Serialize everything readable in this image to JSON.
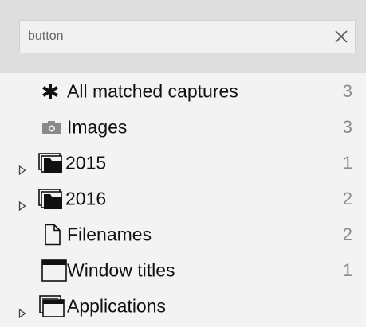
{
  "search": {
    "value": "button",
    "clear_icon": "close-icon"
  },
  "items": [
    {
      "label": "All matched captures",
      "count": "3",
      "icon": "asterisk-icon",
      "expandable": false
    },
    {
      "label": "Images",
      "count": "3",
      "icon": "camera-icon",
      "expandable": false
    },
    {
      "label": "2015",
      "count": "1",
      "icon": "stack-folder-icon",
      "expandable": true
    },
    {
      "label": "2016",
      "count": "2",
      "icon": "stack-folder-icon",
      "expandable": true
    },
    {
      "label": "Filenames",
      "count": "2",
      "icon": "file-icon",
      "expandable": false
    },
    {
      "label": "Window titles",
      "count": "1",
      "icon": "window-icon",
      "expandable": false
    },
    {
      "label": "Applications",
      "count": "",
      "icon": "app-window-icon",
      "expandable": true
    }
  ]
}
